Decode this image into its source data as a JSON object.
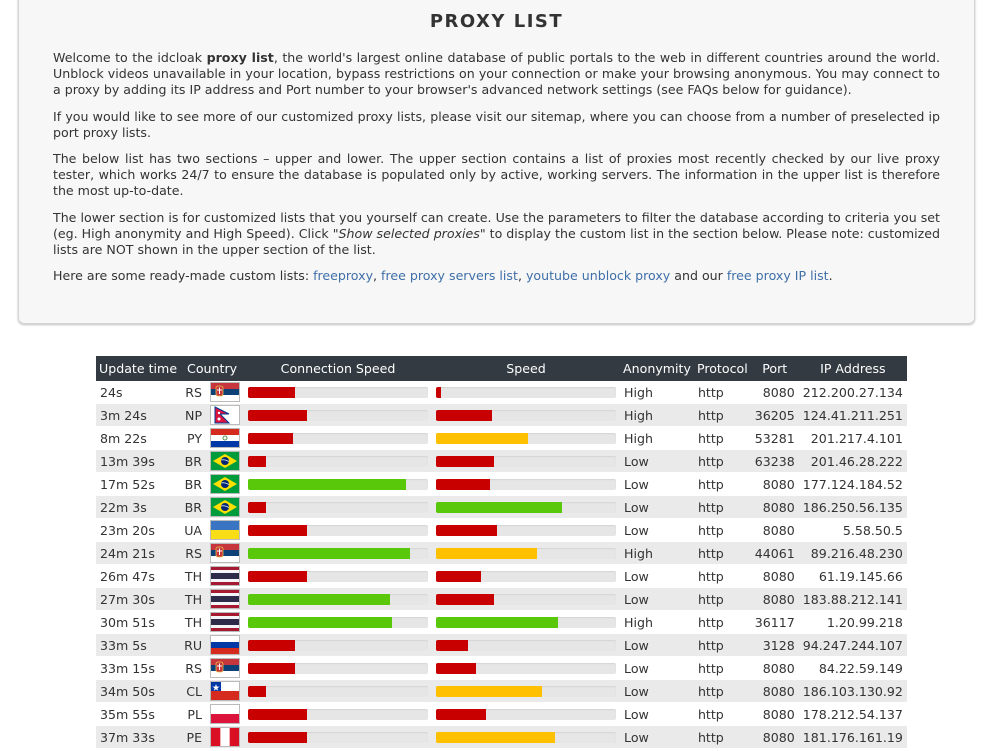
{
  "intro": {
    "title": "PROXY LIST",
    "p1_a": "Welcome to the idcloak ",
    "p1_b": "proxy list",
    "p1_c": ", the world's largest online database of public portals to the web in different countries around the world. Unblock videos unavailable in your location, bypass restrictions on your connection or make your browsing anonymous. You may connect to a proxy by adding its IP address and Port number to your browser's advanced network settings (see FAQs below for guidance).",
    "p2": "If you would like to see more of our customized proxy lists, please visit our sitemap, where you can choose from a number of preselected ip port proxy lists.",
    "p3": "The below list has two sections – upper and lower. The upper section contains a list of proxies most recently checked by our live proxy tester, which works 24/7 to ensure the database is populated only by active, working servers. The information in the upper list is therefore the most up-to-date.",
    "p4_a": "The lower section is for customized lists that you yourself can create. Use the parameters to filter the database according to criteria you set (eg. High anonymity and High Speed). Click ",
    "p4_b": "\"Show selected proxies\"",
    "p4_c": " to display the custom list in the section below. Please note: customized lists are NOT shown in the upper section of the list.",
    "p5_a": "Here are some ready-made custom lists: ",
    "link1": "freeproxy",
    "sep1": ", ",
    "link2": "free proxy servers list",
    "sep2": ", ",
    "link3": "youtube unblock proxy",
    "p5_b": " and our ",
    "link4": "free proxy IP list",
    "p5_c": "."
  },
  "table": {
    "headers": [
      "Update time",
      "Country",
      "Connection Speed",
      "Speed",
      "Anonymity",
      "Protocol",
      "Port",
      "IP Address"
    ],
    "colors": {
      "red": "#c80000",
      "yellow": "#ffc000",
      "green": "#5ac80a",
      "header_bg": "#333a42"
    },
    "rows": [
      {
        "time": "24s",
        "country": "RS",
        "flag": "serbia-flag",
        "conn": 0.26,
        "connColor": "red",
        "speed": 0.03,
        "speedColor": "red",
        "anon": "High",
        "proto": "http",
        "port": "8080",
        "ip": "212.200.27.134"
      },
      {
        "time": "3m 24s",
        "country": "NP",
        "flag": "nepal-flag",
        "conn": 0.33,
        "connColor": "red",
        "speed": 0.31,
        "speedColor": "red",
        "anon": "High",
        "proto": "http",
        "port": "36205",
        "ip": "124.41.211.251"
      },
      {
        "time": "8m 22s",
        "country": "PY",
        "flag": "paraguay-flag",
        "conn": 0.25,
        "connColor": "red",
        "speed": 0.51,
        "speedColor": "yellow",
        "anon": "High",
        "proto": "http",
        "port": "53281",
        "ip": "201.217.4.101"
      },
      {
        "time": "13m 39s",
        "country": "BR",
        "flag": "brazil-flag",
        "conn": 0.1,
        "connColor": "red",
        "speed": 0.32,
        "speedColor": "red",
        "anon": "Low",
        "proto": "http",
        "port": "63238",
        "ip": "201.46.28.222"
      },
      {
        "time": "17m 52s",
        "country": "BR",
        "flag": "brazil-flag",
        "conn": 0.88,
        "connColor": "green",
        "speed": 0.3,
        "speedColor": "red",
        "anon": "Low",
        "proto": "http",
        "port": "8080",
        "ip": "177.124.184.52"
      },
      {
        "time": "22m 3s",
        "country": "BR",
        "flag": "brazil-flag",
        "conn": 0.1,
        "connColor": "red",
        "speed": 0.7,
        "speedColor": "green",
        "anon": "Low",
        "proto": "http",
        "port": "8080",
        "ip": "186.250.56.135"
      },
      {
        "time": "23m 20s",
        "country": "UA",
        "flag": "ukraine-flag",
        "conn": 0.33,
        "connColor": "red",
        "speed": 0.34,
        "speedColor": "red",
        "anon": "Low",
        "proto": "http",
        "port": "8080",
        "ip": "5.58.50.5"
      },
      {
        "time": "24m 21s",
        "country": "RS",
        "flag": "serbia-flag",
        "conn": 0.9,
        "connColor": "green",
        "speed": 0.56,
        "speedColor": "yellow",
        "anon": "High",
        "proto": "http",
        "port": "44061",
        "ip": "89.216.48.230"
      },
      {
        "time": "26m 47s",
        "country": "TH",
        "flag": "thailand-flag",
        "conn": 0.33,
        "connColor": "red",
        "speed": 0.25,
        "speedColor": "red",
        "anon": "Low",
        "proto": "http",
        "port": "8080",
        "ip": "61.19.145.66"
      },
      {
        "time": "27m 30s",
        "country": "TH",
        "flag": "thailand-flag",
        "conn": 0.79,
        "connColor": "green",
        "speed": 0.32,
        "speedColor": "red",
        "anon": "Low",
        "proto": "http",
        "port": "8080",
        "ip": "183.88.212.141"
      },
      {
        "time": "30m 51s",
        "country": "TH",
        "flag": "thailand-flag",
        "conn": 0.8,
        "connColor": "green",
        "speed": 0.68,
        "speedColor": "green",
        "anon": "High",
        "proto": "http",
        "port": "36117",
        "ip": "1.20.99.218"
      },
      {
        "time": "33m 5s",
        "country": "RU",
        "flag": "russia-flag",
        "conn": 0.26,
        "connColor": "red",
        "speed": 0.18,
        "speedColor": "red",
        "anon": "Low",
        "proto": "http",
        "port": "3128",
        "ip": "94.247.244.107"
      },
      {
        "time": "33m 15s",
        "country": "RS",
        "flag": "serbia-flag",
        "conn": 0.26,
        "connColor": "red",
        "speed": 0.22,
        "speedColor": "red",
        "anon": "Low",
        "proto": "http",
        "port": "8080",
        "ip": "84.22.59.149"
      },
      {
        "time": "34m 50s",
        "country": "CL",
        "flag": "chile-flag",
        "conn": 0.1,
        "connColor": "red",
        "speed": 0.59,
        "speedColor": "yellow",
        "anon": "Low",
        "proto": "http",
        "port": "8080",
        "ip": "186.103.130.92"
      },
      {
        "time": "35m 55s",
        "country": "PL",
        "flag": "poland-flag",
        "conn": 0.33,
        "connColor": "red",
        "speed": 0.28,
        "speedColor": "red",
        "anon": "Low",
        "proto": "http",
        "port": "8080",
        "ip": "178.212.54.137"
      },
      {
        "time": "37m 33s",
        "country": "PE",
        "flag": "peru-flag",
        "conn": 0.33,
        "connColor": "red",
        "speed": 0.66,
        "speedColor": "yellow",
        "anon": "Low",
        "proto": "http",
        "port": "8080",
        "ip": "181.176.161.19"
      }
    ]
  }
}
